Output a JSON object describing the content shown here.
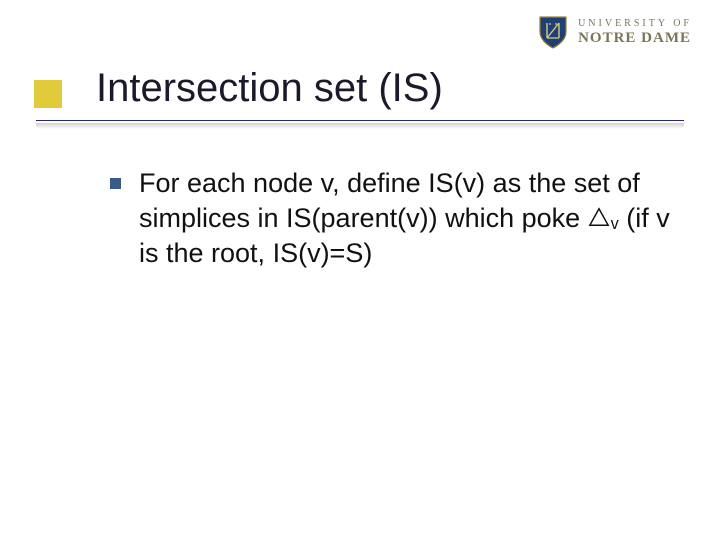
{
  "logo": {
    "line1": "UNIVERSITY OF",
    "line2": "NOTRE DAME",
    "icon": "shield-icon"
  },
  "title": "Intersection set (IS)",
  "bullets": [
    {
      "text_prefix": "For each node v, define IS(v) as the set of simplices in IS(parent(v)) which poke ",
      "triangle_sub": "v",
      "text_suffix": " (if v is the root, IS(v)=S)"
    }
  ],
  "colors": {
    "accent_gold": "#e0c830",
    "bullet_blue": "#3a5a88",
    "rule_blue": "#282870",
    "logo_khaki": "#7a7557"
  }
}
